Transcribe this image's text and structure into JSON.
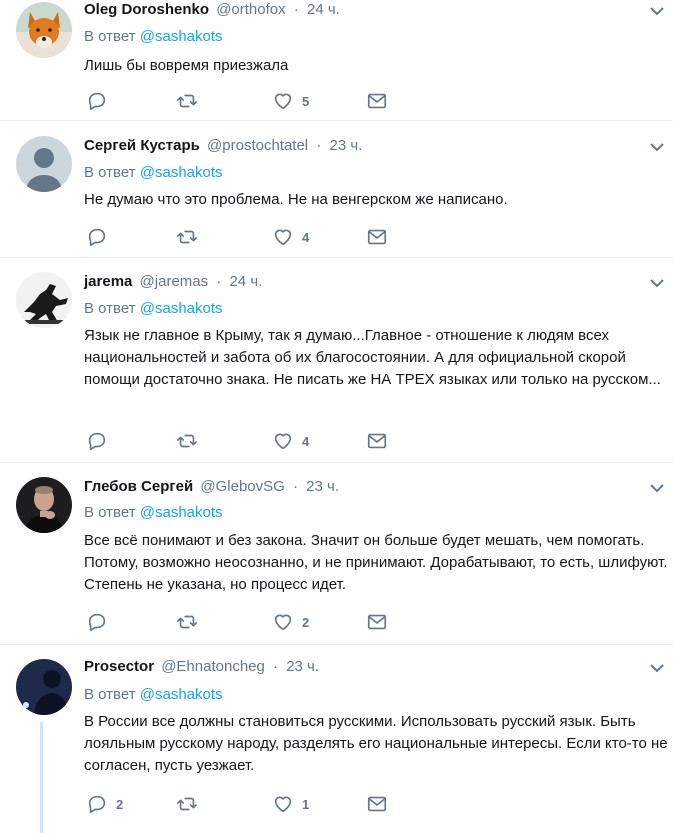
{
  "reply_prefix": "В ответ",
  "tweets": [
    {
      "name": "Oleg Doroshenko",
      "handle": "@orthofox",
      "time": "24 ч.",
      "reply_to": "@sashakots",
      "text": "Лишь бы вовремя приезжала",
      "replies": "",
      "retweets": "",
      "likes": "5",
      "avatar_icon": "fox-avatar"
    },
    {
      "name": "Сергей Кустарь",
      "handle": "@prostochtatel",
      "time": "23 ч.",
      "reply_to": "@sashakots",
      "text": "Не думаю что это проблема. Не на венгерском же написано.",
      "replies": "",
      "retweets": "",
      "likes": "4",
      "avatar_icon": "default-avatar"
    },
    {
      "name": "jarema",
      "handle": "@jaremas",
      "time": "24 ч.",
      "reply_to": "@sashakots",
      "text": "Язык не главное в Крыму, так я думаю...Главное - отношение к людям всех национальностей и забота об их благосостоянии. А для официальной скорой помощи достаточно знака. Не писать же НА ТРЕХ языках или только на русском...",
      "replies": "",
      "retweets": "",
      "likes": "4",
      "avatar_icon": "silhouette-avatar"
    },
    {
      "name": "Глебов Сергей",
      "handle": "@GlebovSG",
      "time": "23 ч.",
      "reply_to": "@sashakots",
      "text": "Все всё понимают и без закона. Значит он больше будет мешать, чем помогать. Потому, возможно неосознанно, и не принимают. Дорабатывают, то есть, шлифуют. Степень не указана, но процесс идет.",
      "replies": "",
      "retweets": "",
      "likes": "2",
      "avatar_icon": "portrait-avatar"
    },
    {
      "name": "Prosector",
      "handle": "@Ehnatoncheg",
      "time": "23 ч.",
      "reply_to": "@sashakots",
      "text": "В России все должны становиться русскими. Использовать русский язык. Быть лояльным русскому народу, разделять его национальные интересы. Если кто-то не согласен, пусть уезжает.",
      "replies": "2",
      "retweets": "",
      "likes": "1",
      "avatar_icon": "dark-figure-avatar"
    }
  ]
}
